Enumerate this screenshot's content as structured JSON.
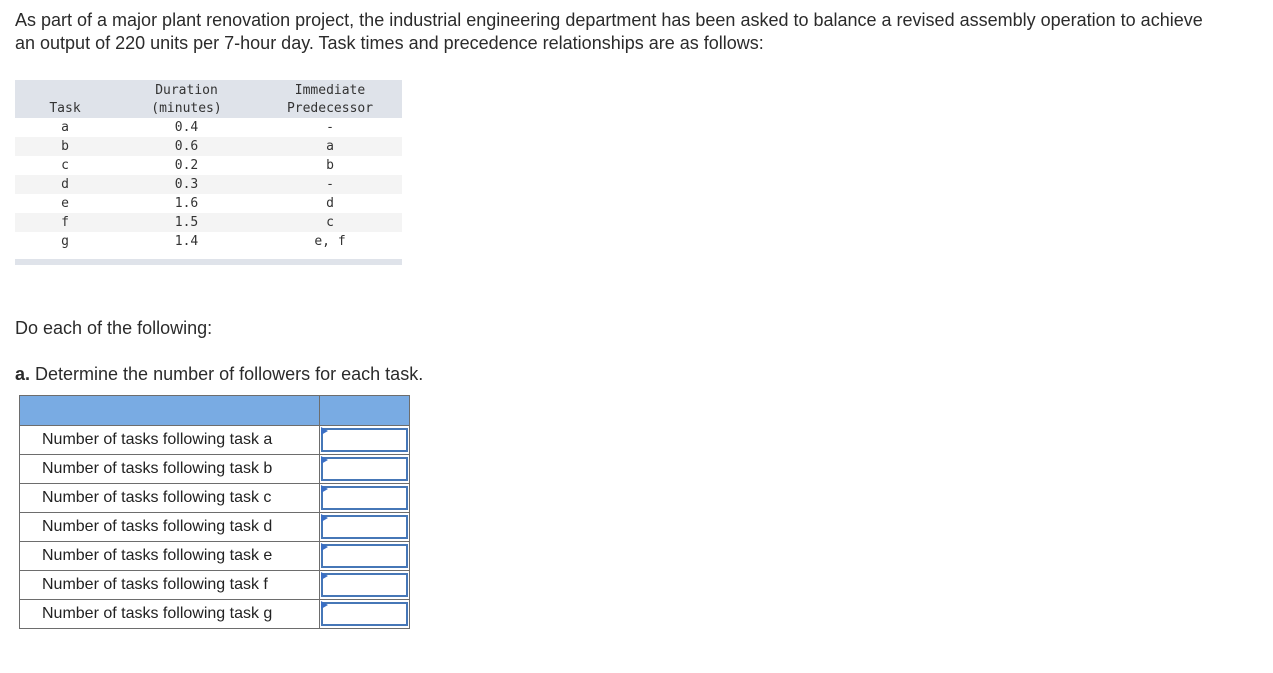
{
  "intro": "As part of a major plant renovation project, the industrial engineering department has been asked to balance a revised assembly operation to achieve an output of 220 units per 7-hour day. Task times and precedence relationships are as follows:",
  "task_table": {
    "headers": {
      "task": "Task",
      "duration_line1": "Duration",
      "duration_line2": "(minutes)",
      "pred_line1": "Immediate",
      "pred_line2": "Predecessor"
    },
    "rows": [
      {
        "task": "a",
        "duration": "0.4",
        "predecessor": "-"
      },
      {
        "task": "b",
        "duration": "0.6",
        "predecessor": "a"
      },
      {
        "task": "c",
        "duration": "0.2",
        "predecessor": "b"
      },
      {
        "task": "d",
        "duration": "0.3",
        "predecessor": "-"
      },
      {
        "task": "e",
        "duration": "1.6",
        "predecessor": "d"
      },
      {
        "task": "f",
        "duration": "1.5",
        "predecessor": "c"
      },
      {
        "task": "g",
        "duration": "1.4",
        "predecessor": "e, f"
      }
    ]
  },
  "instructions": "Do each of the following:",
  "part_a": {
    "letter": "a.",
    "text": " Determine the number of followers for each task."
  },
  "answer_table": {
    "header_label": "",
    "header_value": "",
    "rows": [
      {
        "label": "Number of tasks following task a",
        "value": ""
      },
      {
        "label": "Number of tasks following task b",
        "value": ""
      },
      {
        "label": "Number of tasks following task c",
        "value": ""
      },
      {
        "label": "Number of tasks following task d",
        "value": ""
      },
      {
        "label": "Number of tasks following task e",
        "value": ""
      },
      {
        "label": "Number of tasks following task f",
        "value": ""
      },
      {
        "label": "Number of tasks following task g",
        "value": ""
      }
    ]
  },
  "colors": {
    "header_blue": "#79abe3",
    "input_border": "#4677b7",
    "table_header_gray": "#dfe3ea"
  }
}
